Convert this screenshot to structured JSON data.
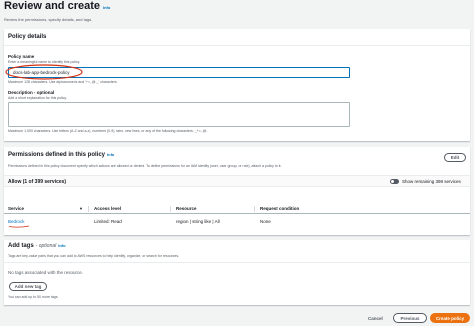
{
  "header": {
    "title": "Review and create",
    "info": "Info",
    "subtitle": "Review the permissions, specify details, and tags."
  },
  "policy_details": {
    "title": "Policy details",
    "name_label": "Policy name",
    "name_hint": "Enter a meaningful name to identify this policy.",
    "name_value": "docs-lab-app-bedrock-policy",
    "name_constraint": "Maximum 128 characters. Use alphanumeric and '+=,.@-_' characters.",
    "desc_label": "Description - optional",
    "desc_hint": "Add a short explanation for this policy.",
    "desc_value": "",
    "desc_constraint": "Maximum 1,000 characters. Use letters (A-Z and a-z), numbers (0-9), tabs, new lines, or any of the following characters: _+=,.@-"
  },
  "permissions": {
    "title": "Permissions defined in this policy",
    "info": "Info",
    "description": "Permissions defined in this policy document specify which actions are allowed or denied. To define permissions for an IAM identity (user, user group, or role), attach a policy to it.",
    "edit_label": "Edit",
    "allow_label": "Allow (1 of 399 services)",
    "toggle_label": "Show remaining 398 services",
    "columns": [
      "Service",
      "Access level",
      "Resource",
      "Request condition"
    ],
    "rows": [
      {
        "service": "Bedrock",
        "access": "Limited: Read",
        "resource": "region | string like | All",
        "condition": "None"
      }
    ]
  },
  "tags": {
    "title": "Add tags",
    "optional": "- optional",
    "info": "Info",
    "description": "Tags are key-value pairs that you can add to AWS resources to help identify, organize, or search for resources.",
    "empty_text": "No tags associated with the resource.",
    "add_label": "Add new tag",
    "limit_text": "You can add up to 50 more tags."
  },
  "footer": {
    "cancel_label": "Cancel",
    "previous_label": "Previous",
    "create_label": "Create policy"
  },
  "colors": {
    "accent": "#0073bb",
    "primary_button": "#ec7211",
    "annotation": "#d13212"
  }
}
